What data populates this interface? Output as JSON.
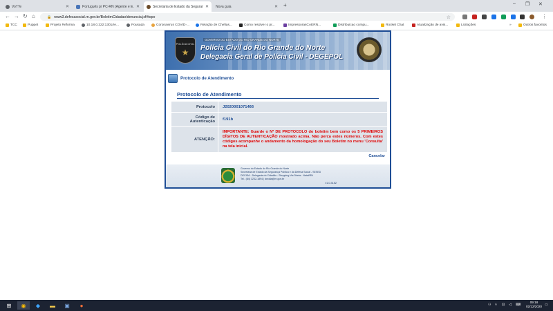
{
  "browser": {
    "tabs": [
      {
        "title": "VoTTe",
        "active": false
      },
      {
        "title": "Português p/ PC-RN (Agente e E...",
        "active": false
      },
      {
        "title": "Secretaria de Estado da Seguran...",
        "active": true
      },
      {
        "title": "Nova guia",
        "active": false
      }
    ],
    "url": "www3.defesasocial.rn.gov.br/BoletimCidadao/denuncia.jsf#topo",
    "bookmarks": [
      "TCC",
      "Puppet",
      "Projeto Reforma",
      "10.18.0.222:1301/re...",
      "Pousada",
      "Coronavirus COVID-...",
      "Relação de Chefias...",
      "Como resolver o pr...",
      "ImpressorasCAERN...",
      "Distribuicao compu...",
      "Rocket Chat",
      "Atualização de avis...",
      "Licitações"
    ],
    "other_bookmarks": "Outros favoritos"
  },
  "banner": {
    "small_text": "GOVERNO DO ESTADO DO RIO GRANDE DO NORTE",
    "line1": "Polícia Civil do Rio Grande do Norte",
    "line2": "Delegacia Geral de Polícia Civil - DEGEPOL",
    "badge_text": "POLÍCIA CIVIL"
  },
  "section": {
    "title": "Protocolo de Atendimento"
  },
  "box": {
    "title": "Protocolo de Atendimento",
    "rows": [
      {
        "label": "Protocolo",
        "value": "J2020001071466"
      },
      {
        "label": "Código de Autenticação",
        "value": "f191b"
      }
    ],
    "attention_label": "ATENÇÃO:",
    "attention_text": "IMPORTANTE: Guarde o Nº DE PROTOCOLO do boletim bem como os 5 PRIMEIROS DÍGITOS DE AUTENTICAÇÃO mostrado acima. Não perca estes números. Com estes códigos acompanhe o andamento da homologação do seu Boletim no menu 'Consulta' na tela inicial.",
    "cancel_label": "Cancelar"
  },
  "footer": {
    "line1": "Governo do Estado do Rio Grande do Norte",
    "line2": "Secretaria de Estado da Segurança Pública e da Defesa Social - SESED",
    "line3": "DECIDA - Delegacia do Cidadão - Shopping Via Direta - Natal/RN",
    "line4": "Tel.: (84) 3232-1894  |  decida@rn.gov.br",
    "version": "v1.0.3152"
  },
  "taskbar": {
    "time": "09:18",
    "date": "02/12/2020"
  }
}
